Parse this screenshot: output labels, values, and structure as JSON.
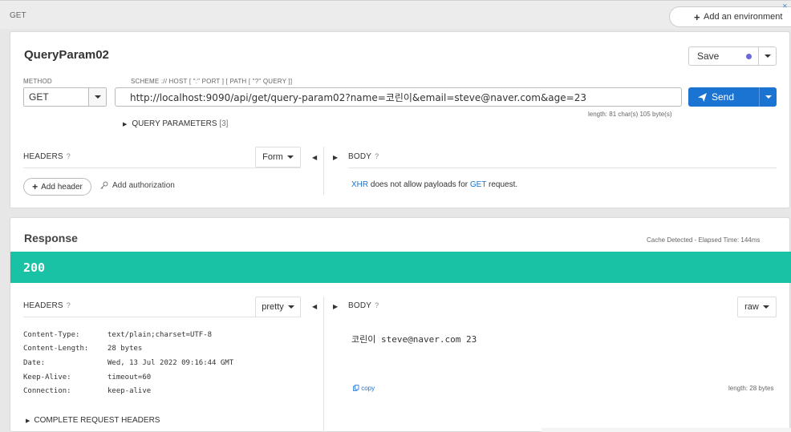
{
  "topbar": {
    "method": "GET",
    "add_environment": "Add an environment",
    "corner_icon": "close-icon"
  },
  "request": {
    "title": "QueryParam02",
    "save_label": "Save",
    "method_label": "METHOD",
    "scheme_label": "SCHEME :// HOST [ \":\" PORT ] [ PATH [ \"?\" QUERY ]]",
    "method_value": "GET",
    "url": "http://localhost:9090/api/get/query-param02?name=코린이&email=steve@naver.com&age=23",
    "send_label": "Send",
    "length_info": "length: 81 char(s) 105 byte(s)",
    "query_params_label": "QUERY PARAMETERS",
    "query_params_count": "[3]",
    "headers_label": "HEADERS",
    "headers_mode": "Form",
    "body_label": "BODY",
    "add_header_label": "Add header",
    "add_authorization_label": "Add authorization",
    "xhr_msg": {
      "part1": "XHR",
      "part2": " does not allow payloads for ",
      "part3": "GET",
      "part4": " request."
    }
  },
  "response": {
    "title": "Response",
    "cache_info": "Cache Detected - Elapsed Time: 144ms",
    "status_code": "200",
    "headers_label": "HEADERS",
    "headers_mode": "pretty",
    "body_label": "BODY",
    "body_mode": "raw",
    "headers": [
      {
        "key": "Content-Type:",
        "value": "text/plain;charset=UTF-8"
      },
      {
        "key": "Content-Length:",
        "value": "28 bytes"
      },
      {
        "key": "Date:",
        "value": "Wed, 13 Jul 2022 09:16:44 GMT"
      },
      {
        "key": "Keep-Alive:",
        "value": "timeout=60"
      },
      {
        "key": "Connection:",
        "value": "keep-alive"
      }
    ],
    "complete_request_headers": "COMPLETE REQUEST HEADERS",
    "body_text": "코린이 steve@naver.com 23",
    "copy_label": "copy",
    "length_bytes": "length: 28 bytes"
  },
  "colors": {
    "accent_blue": "#1b73d2",
    "status_green": "#19c2a4",
    "save_dot": "#6a67d9"
  }
}
